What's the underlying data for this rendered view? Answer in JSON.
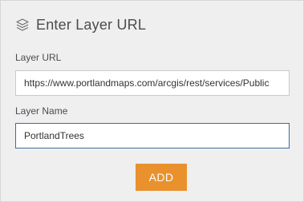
{
  "header": {
    "title": "Enter Layer URL",
    "icon": "layers-icon"
  },
  "url_field": {
    "label": "Layer URL",
    "value": "https://www.portlandmaps.com/arcgis/rest/services/Public"
  },
  "name_field": {
    "label": "Layer Name",
    "value": "PortlandTrees"
  },
  "actions": {
    "add_label": "ADD"
  },
  "colors": {
    "panel_background": "#efefef",
    "accent_button": "#e8912d",
    "focus_border": "#3d6d99",
    "text": "#4c4c4c"
  }
}
